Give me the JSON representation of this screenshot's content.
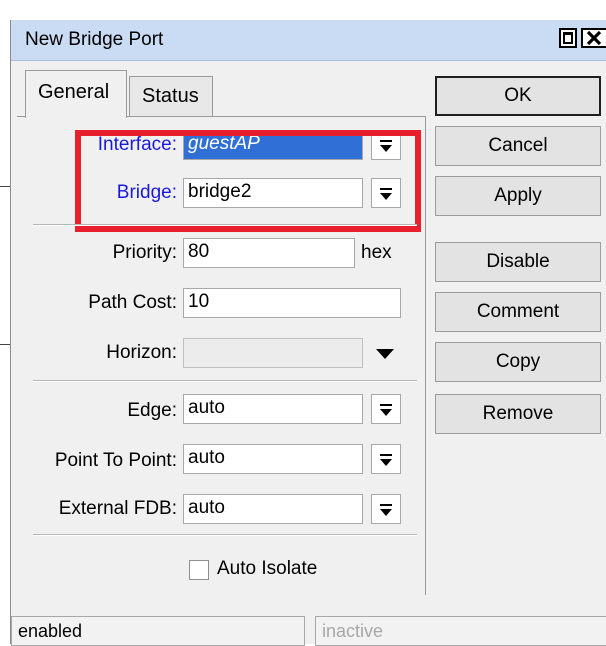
{
  "window": {
    "title": "New Bridge Port"
  },
  "tabs": [
    {
      "label": "General"
    },
    {
      "label": "Status"
    }
  ],
  "form": {
    "interface": {
      "label": "Interface:",
      "value": "guestAP"
    },
    "bridge": {
      "label": "Bridge:",
      "value": "bridge2"
    },
    "priority": {
      "label": "Priority:",
      "value": "80",
      "unit": "hex"
    },
    "path_cost": {
      "label": "Path Cost:",
      "value": "10"
    },
    "horizon": {
      "label": "Horizon:",
      "value": ""
    },
    "edge": {
      "label": "Edge:",
      "value": "auto"
    },
    "point_to_point": {
      "label": "Point To Point:",
      "value": "auto"
    },
    "external_fdb": {
      "label": "External FDB:",
      "value": "auto"
    },
    "auto_isolate": {
      "label": "Auto Isolate",
      "checked": false
    }
  },
  "buttons": {
    "ok": "OK",
    "cancel": "Cancel",
    "apply": "Apply",
    "disable": "Disable",
    "comment": "Comment",
    "copy": "Copy",
    "remove": "Remove"
  },
  "status": {
    "left": "enabled",
    "right": "inactive"
  },
  "colors": {
    "highlight": "#e8202e",
    "titlebar": "#c9dcf3",
    "label_blue": "#1a1adb",
    "selection": "#2f6fd6"
  }
}
